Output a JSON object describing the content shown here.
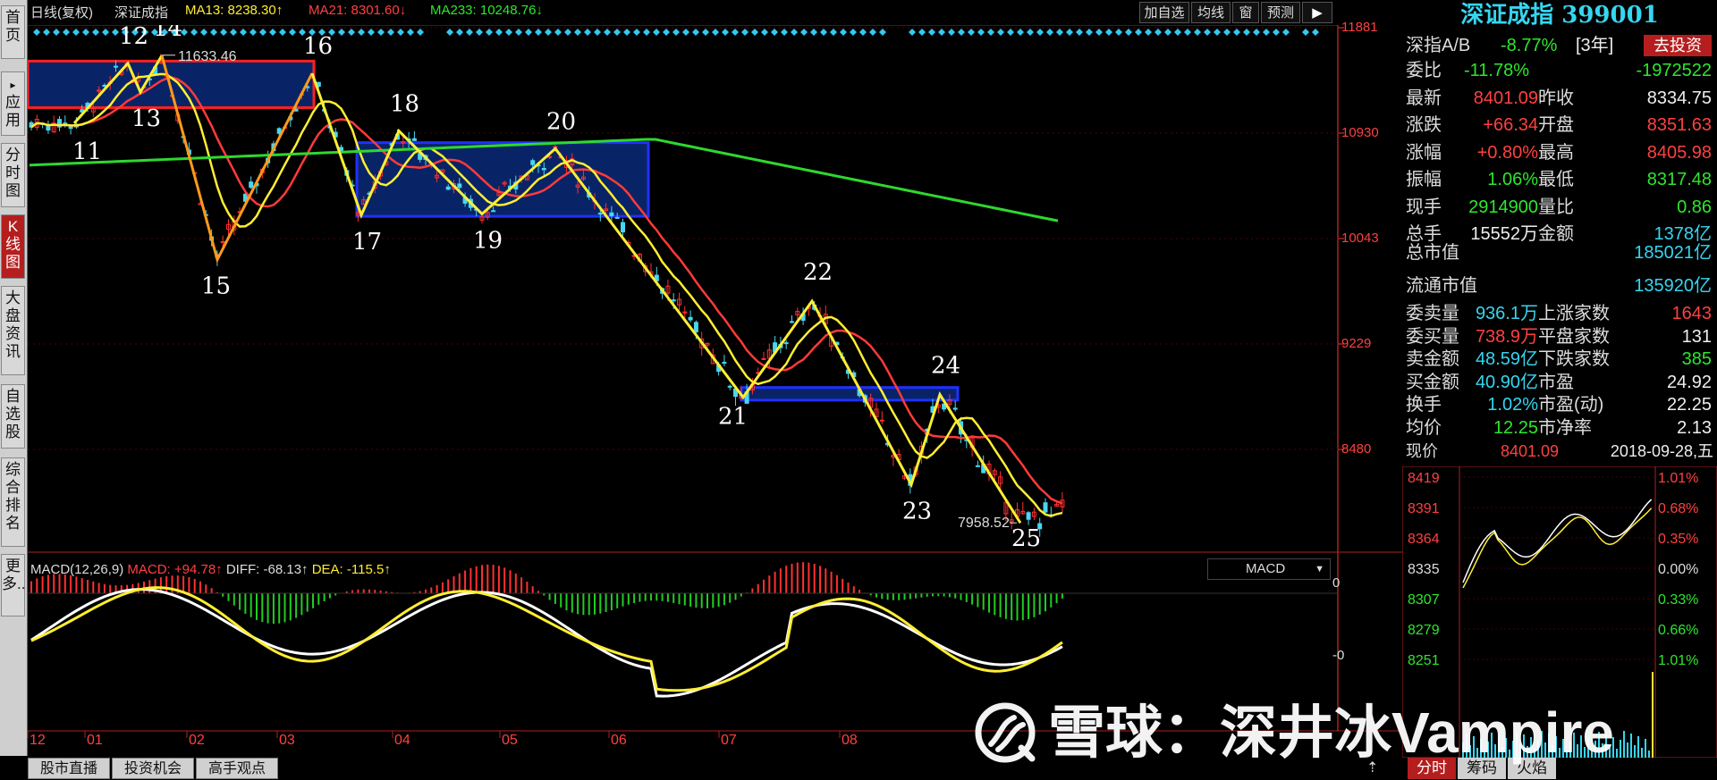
{
  "left_nav": [
    "首页",
    "应用",
    "分时图",
    "K线图",
    "大盘资讯",
    "自选股",
    "综合排名",
    "更多.."
  ],
  "header": {
    "period": "日线(复权)",
    "name": "深证成指",
    "ma13": "MA13: 8238.30↑",
    "ma21": "MA21: 8301.60↓",
    "ma233": "MA233: 10248.76↓",
    "buttons": [
      "加自选",
      "均线",
      "窗",
      "预测"
    ]
  },
  "chart_data": [
    {
      "type": "candlestick",
      "title": "",
      "y_ticks": [
        11881,
        10930,
        10043,
        9229,
        8480
      ],
      "ylim": [
        7600,
        11881
      ],
      "x_month_labels": [
        "12",
        "01",
        "02",
        "03",
        "04",
        "05",
        "06",
        "07",
        "08"
      ],
      "annotations": [
        {
          "label": "11633.46",
          "type": "high"
        },
        {
          "label": "7958.52",
          "type": "low"
        }
      ],
      "wave_points": [
        {
          "label": "11",
          "value": 11020
        },
        {
          "label": "12",
          "value": 11560
        },
        {
          "label": "13",
          "value": 11300
        },
        {
          "label": "14",
          "value": 11630
        },
        {
          "label": "15",
          "value": 9880
        },
        {
          "label": "16",
          "value": 11470
        },
        {
          "label": "17",
          "value": 10240
        },
        {
          "label": "18",
          "value": 10950
        },
        {
          "label": "19",
          "value": 10250
        },
        {
          "label": "20",
          "value": 10800
        },
        {
          "label": "21",
          "value": 8850
        },
        {
          "label": "22",
          "value": 9560
        },
        {
          "label": "23",
          "value": 8230
        },
        {
          "label": "24",
          "value": 8870
        },
        {
          "label": "25",
          "value": 7958
        }
      ],
      "series": [
        {
          "name": "MA13",
          "color": "#ffee33"
        },
        {
          "name": "MA21",
          "color": "#ff3a3a"
        },
        {
          "name": "MA233",
          "color": "#2ed82e"
        }
      ],
      "zones": [
        {
          "from": "12",
          "to": "03",
          "top": 11580,
          "bottom": 11160
        },
        {
          "from": "04",
          "to": "06",
          "top": 10850,
          "bottom": 10230
        },
        {
          "from": "07",
          "to": "08",
          "top": 8920,
          "bottom": 8830
        }
      ]
    },
    {
      "type": "macd",
      "title": "MACD(12,26,9)",
      "macd": "MACD: +94.78↑",
      "diff": "DIFF: -68.13↑",
      "dea": "DEA: -115.5↑",
      "y_ticks": [
        "0",
        "-0"
      ],
      "dropdown": "MACD"
    }
  ],
  "panel": {
    "title": "深证成指 399001",
    "ab_label": "深指A/B",
    "ab_value": "-8.77%",
    "ab_period": "[3年]",
    "invest_btn": "去投资",
    "rows": [
      {
        "l1": "委比",
        "v1": "-11.78%",
        "c1": "green",
        "v2": "-1972522",
        "c2": "green"
      },
      {
        "l1": "最新",
        "v1": "8401.09",
        "c1": "red",
        "l2": "昨收",
        "v2": "8334.75",
        "c2": "white"
      },
      {
        "l1": "涨跌",
        "v1": "+66.34",
        "c1": "red",
        "l2": "开盘",
        "v2": "8351.63",
        "c2": "red"
      },
      {
        "l1": "涨幅",
        "v1": "+0.80%",
        "c1": "red",
        "l2": "最高",
        "v2": "8405.98",
        "c2": "red"
      },
      {
        "l1": "振幅",
        "v1": "1.06%",
        "c1": "green",
        "l2": "最低",
        "v2": "8317.48",
        "c2": "green"
      },
      {
        "l1": "现手",
        "v1": "2914900",
        "c1": "green",
        "l2": "量比",
        "v2": "0.86",
        "c2": "green"
      },
      {
        "l1": "总手",
        "v1": "15552万",
        "c1": "white",
        "l2": "金额",
        "v2": "1378亿",
        "c2": "cyan"
      }
    ],
    "mcap_label": "总市值",
    "mcap_value": "185021亿",
    "float_label": "流通市值",
    "float_value": "135920亿",
    "rows2": [
      {
        "l1": "委卖量",
        "v1": "936.1万",
        "c1": "cyan",
        "l2": "上涨家数",
        "v2": "1643",
        "c2": "red"
      },
      {
        "l1": "委买量",
        "v1": "738.9万",
        "c1": "red",
        "l2": "平盘家数",
        "v2": "131",
        "c2": "white"
      },
      {
        "l1": "卖金额",
        "v1": "48.59亿",
        "c1": "cyan",
        "l2": "下跌家数",
        "v2": "385",
        "c2": "green"
      },
      {
        "l1": "买金额",
        "v1": "40.90亿",
        "c1": "cyan",
        "l2": "市盈",
        "v2": "24.92",
        "c2": "white"
      },
      {
        "l1": "换手",
        "v1": "1.02%",
        "c1": "cyan",
        "l2": "市盈(动)",
        "v2": "22.25",
        "c2": "white"
      },
      {
        "l1": "均价",
        "v1": "12.25",
        "c1": "green",
        "l2": "市净率",
        "v2": "2.13",
        "c2": "white"
      }
    ],
    "now_label": "现价",
    "now_value": "8401.09",
    "date": "2018-09-28,五",
    "mini_chart": {
      "type": "line",
      "y_left": [
        "8419",
        "8391",
        "8364",
        "8335",
        "8307",
        "8279",
        "8251"
      ],
      "y_right": [
        "1.01%",
        "0.68%",
        "0.35%",
        "0.00%",
        "0.33%",
        "0.66%",
        "1.01%"
      ]
    },
    "tabs": [
      "分时",
      "筹码",
      "火焰"
    ]
  },
  "bottom_tabs": [
    "股市直播",
    "投资机会",
    "高手观点"
  ],
  "watermark": "雪球：深井冰Vampire"
}
